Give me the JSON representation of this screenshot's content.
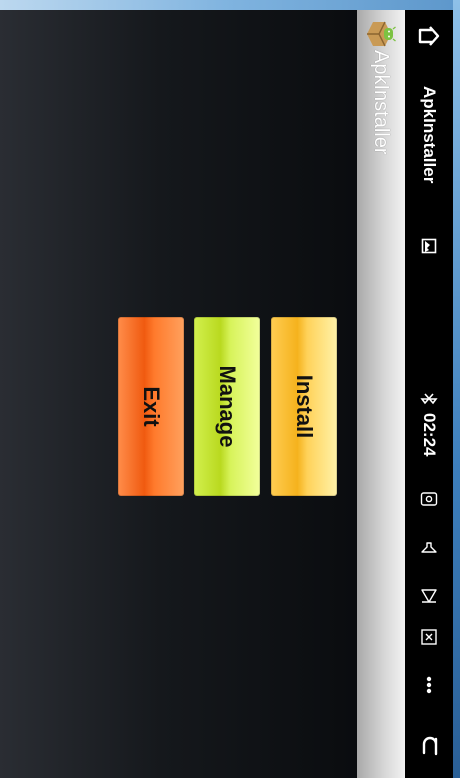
{
  "status_bar": {
    "app_title": "ApkInstaller",
    "time": "02:24",
    "icons": {
      "home": "home-icon",
      "notification": "picture-notification-icon",
      "bluetooth": "bluetooth-icon",
      "screenshot": "screenshot-icon",
      "volume": "volume-icon",
      "forward": "forward-icon",
      "close": "close-box-icon",
      "more": "more-icon",
      "back": "back-icon"
    }
  },
  "action_bar": {
    "title": "ApkInstaller",
    "logo": "android-package-icon"
  },
  "buttons": {
    "install": "Install",
    "manage": "Manage",
    "exit": "Exit"
  },
  "colors": {
    "install": "#ffd25a",
    "manage": "#d7f35a",
    "exit": "#ff7a2c",
    "background": "#15181c"
  }
}
